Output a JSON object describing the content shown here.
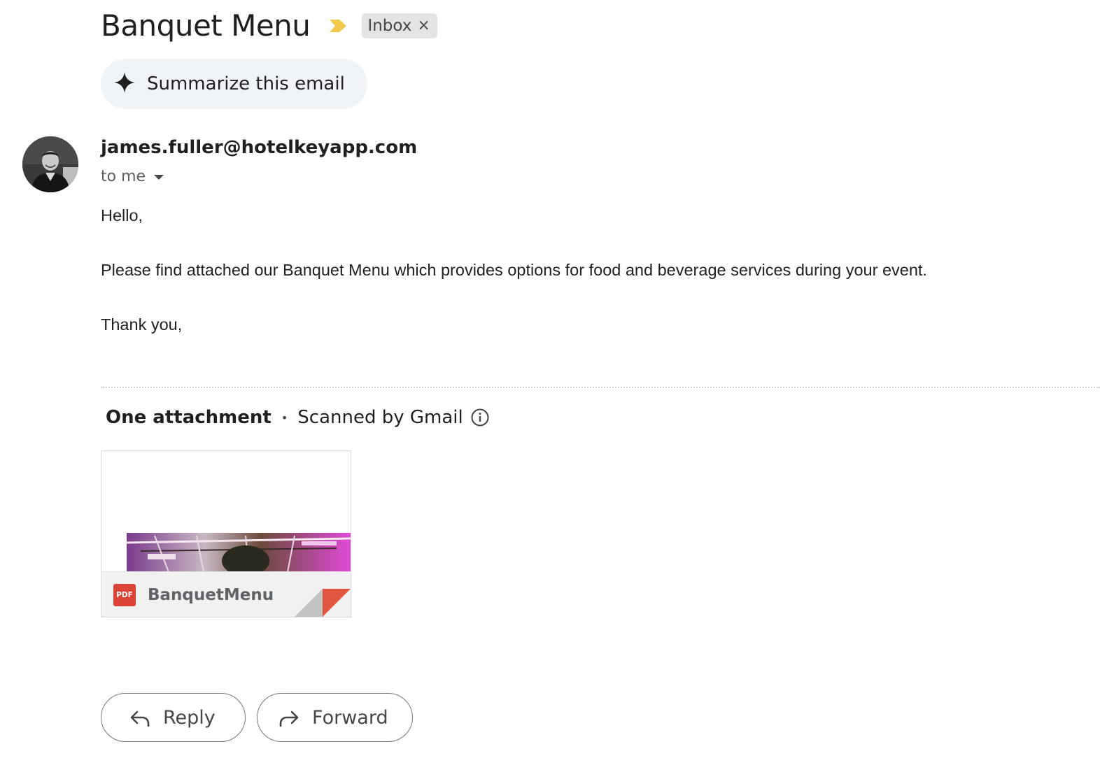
{
  "thread": {
    "subject": "Banquet Menu",
    "label": "Inbox",
    "label_remove": "×"
  },
  "summarize": {
    "label": "Summarize this email"
  },
  "message": {
    "sender_email": "james.fuller@hotelkeyapp.com",
    "recipient_summary": "to me",
    "body": {
      "greeting": "Hello,",
      "main": "Please find attached our Banquet Menu which provides options for food and beverage services during your event.",
      "closing": "Thank you,"
    }
  },
  "attachments": {
    "count_label": "One attachment",
    "separator": "•",
    "scan_label": "Scanned by Gmail",
    "items": [
      {
        "name": "BanquetMenu",
        "type_badge": "PDF"
      }
    ]
  },
  "actions": {
    "reply_label": "Reply",
    "forward_label": "Forward"
  },
  "colors": {
    "importance": "#f2c94c",
    "pdf": "#db4437",
    "summarize_bg": "#f0f4f9"
  },
  "icons": {
    "importance": "importance-marker-icon",
    "summarize": "sparkle-icon",
    "recipient_toggle": "caret-down-icon",
    "info": "info-icon",
    "reply": "reply-arrow-icon",
    "forward": "forward-arrow-icon"
  }
}
